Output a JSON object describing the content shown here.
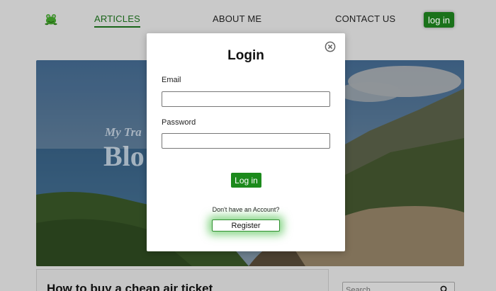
{
  "nav": {
    "logo_icon": "frog-icon",
    "links": [
      {
        "label": "ARTICLES",
        "active": true
      },
      {
        "label": "ABOUT ME",
        "active": false
      },
      {
        "label": "CONTACT US",
        "active": false
      }
    ],
    "login_label": "log in",
    "accent_color": "#1c7a1c"
  },
  "hero": {
    "subtitle": "My Tra",
    "title": "Blo"
  },
  "article": {
    "title": "How to buy a cheap air ticket"
  },
  "search": {
    "placeholder": "Search",
    "icon": "search-icon"
  },
  "modal": {
    "title": "Login",
    "close_icon": "close-circle-icon",
    "email_label": "Email",
    "email_value": "",
    "password_label": "Password",
    "password_value": "",
    "submit_label": "Log in",
    "no_account_text": "Don't have an Account?",
    "register_label": "Register"
  }
}
